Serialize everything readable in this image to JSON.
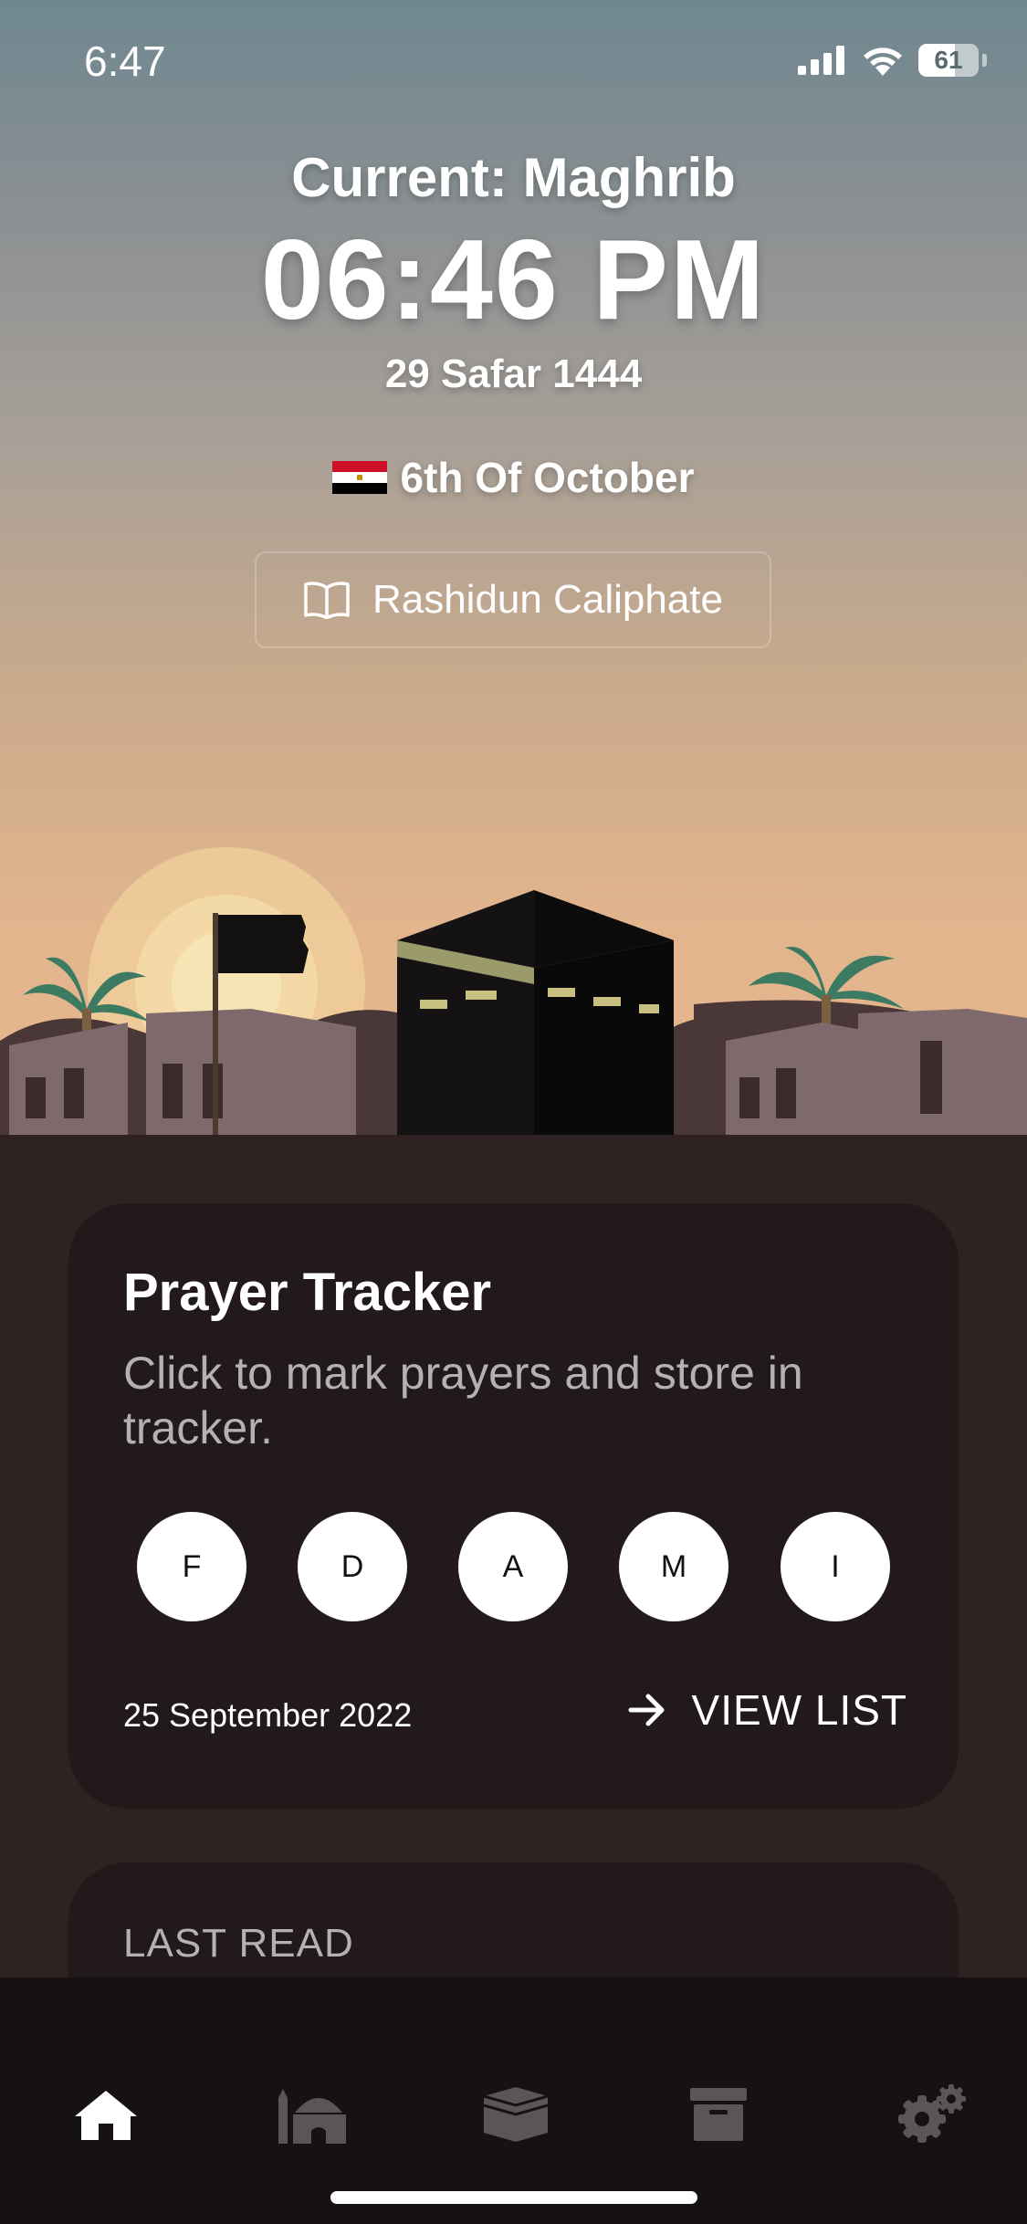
{
  "status_bar": {
    "time": "6:47",
    "battery": "61",
    "battery_level": 0.61
  },
  "prayer": {
    "current": "Current: Maghrib",
    "time": "06:46 PM",
    "hijri_date": "29 Safar 1444"
  },
  "location": {
    "name": "6th Of October",
    "flag": "egypt-flag"
  },
  "era_button": {
    "label": "Rashidun Caliphate",
    "icon": "book-open-icon"
  },
  "tracker": {
    "title": "Prayer Tracker",
    "subtitle": "Click to mark prayers and store in tracker.",
    "prayers": [
      "F",
      "D",
      "A",
      "M",
      "I"
    ],
    "date": "25 September 2022",
    "view_list": "VIEW LIST"
  },
  "last_read": {
    "label": "LAST READ"
  },
  "tabs": [
    {
      "name": "home",
      "icon": "home-icon",
      "active": true
    },
    {
      "name": "mosque",
      "icon": "mosque-icon",
      "active": false
    },
    {
      "name": "quran",
      "icon": "quran-icon",
      "active": false
    },
    {
      "name": "archive",
      "icon": "archive-icon",
      "active": false
    },
    {
      "name": "settings",
      "icon": "settings-icon",
      "active": false
    }
  ],
  "colors": {
    "background": "#2e2222",
    "card": "#221a1a",
    "tabbar": "#171212",
    "active_tab": "#ffffff",
    "inactive_tab": "#5c5555",
    "flag_red": "#ce1126",
    "flag_white": "#ffffff",
    "flag_black": "#000000"
  }
}
